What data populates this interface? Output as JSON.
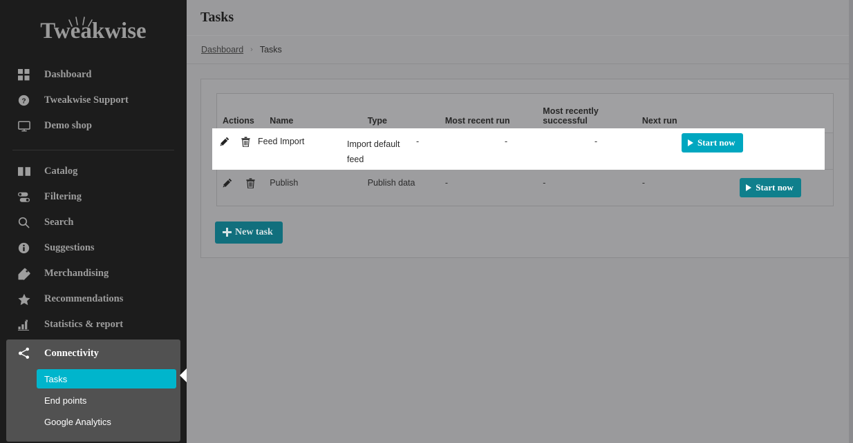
{
  "brand": {
    "logo_text": "Tweakwise"
  },
  "sidebar": {
    "top_items": [
      {
        "label": "Dashboard",
        "icon": "grid-icon"
      },
      {
        "label": "Tweakwise Support",
        "icon": "help-circle-icon"
      },
      {
        "label": "Demo shop",
        "icon": "monitor-icon"
      }
    ],
    "main_items": [
      {
        "label": "Catalog",
        "icon": "book-icon"
      },
      {
        "label": "Filtering",
        "icon": "sliders-icon"
      },
      {
        "label": "Search",
        "icon": "magnifier-icon"
      },
      {
        "label": "Suggestions",
        "icon": "info-circle-icon"
      },
      {
        "label": "Merchandising",
        "icon": "tag-icon"
      },
      {
        "label": "Recommendations",
        "icon": "star-icon"
      },
      {
        "label": "Statistics & report",
        "icon": "bar-chart-icon"
      }
    ],
    "connectivity": {
      "label": "Connectivity",
      "icon": "share-nodes-icon",
      "sub_items": [
        {
          "label": "Tasks",
          "active": true
        },
        {
          "label": "End points",
          "active": false
        },
        {
          "label": "Google Analytics",
          "active": false
        }
      ]
    }
  },
  "header": {
    "title": "Tasks"
  },
  "breadcrumb": {
    "root": "Dashboard",
    "separator": "›",
    "current": "Tasks"
  },
  "table": {
    "columns": [
      "Actions",
      "Name",
      "Type",
      "Most recent run",
      "Most recently successful",
      "Next run",
      ""
    ],
    "rows": [
      {
        "name": "Feed Import",
        "type": "Import default feed",
        "most_recent_run": "-",
        "most_recently_successful": "-",
        "next_run": "-",
        "action_label": "Start now",
        "highlighted": true
      },
      {
        "name": "Publish",
        "type": "Publish data",
        "most_recent_run": "-",
        "most_recently_successful": "-",
        "next_run": "-",
        "action_label": "Start now",
        "highlighted": false
      }
    ],
    "edit_icon": "pencil-icon",
    "delete_icon": "trash-icon"
  },
  "actions": {
    "new_task_label": "New task"
  },
  "colors": {
    "sidebar_bg": "#1c1c1c",
    "submenu_bg": "#515151",
    "accent_cyan": "#00b5cc",
    "button_teal": "#0f7f8c",
    "overlay_gray": "#9a9a9c",
    "highlight_white": "#ffffff"
  }
}
